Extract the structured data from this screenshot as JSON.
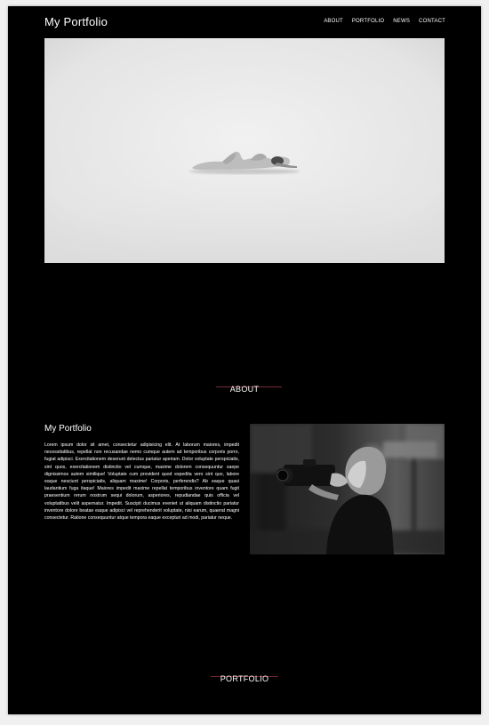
{
  "header": {
    "site_title": "My Portfolio",
    "nav": [
      "ABOUT",
      "PORTFOLIO",
      "NEWS",
      "CONTACT"
    ]
  },
  "hero": {
    "image": "black-and-white photo of a figure lying on a white floor",
    "image_icon": "photo-icon"
  },
  "about": {
    "heading": "ABOUT",
    "title": "My Portfolio",
    "body": "Lorem ipsum dolor sit amet, consectetur adipisicing elit. At laborum maiores, impedit necessitatibus, repellat non recusandae nemo cumque autem ad temporibus corporis porro, fugiat adipisci. Exercitationem deserunt delectus pariatur aperiam. Dolor voluptate perspiciatis, sint quos, exercitationem distinctio vel cumque, maxime dolorem consequuntur saepe dignissimos autem similique! Voluptate cum provident quod expedita vero sint quo, labore eaque nesciunt perspiciatis, aliquam maxime! Corporis, perferendis? Ab eaque quasi laudantium fuga itaque! Maiores impedit maxime repellat temporibus inventore quam fugit praesentium rerum nostrum sequi dolorum, asperiores, repudiandae quis officia vel voluptatibus velit aspernatur. Impedit. Suscipit ducimus eveniet ut aliquam distinctio pariatur inventore dolore beatae eaque adipisci vel reprehenderit voluptate, nisi earum, quaerat magni consectetur. Ratione consequuntur atque tempora eaque excepturi ad modi, pariatur neque.",
    "image": "black-and-white photo of a woman holding a camera",
    "image_icon": "photo-icon"
  },
  "portfolio": {
    "heading": "PORTFOLIO"
  },
  "colors": {
    "background": "#000000",
    "text": "#ffffff",
    "accent_line": "#7a2a36",
    "frame": "#f0f0f0"
  }
}
